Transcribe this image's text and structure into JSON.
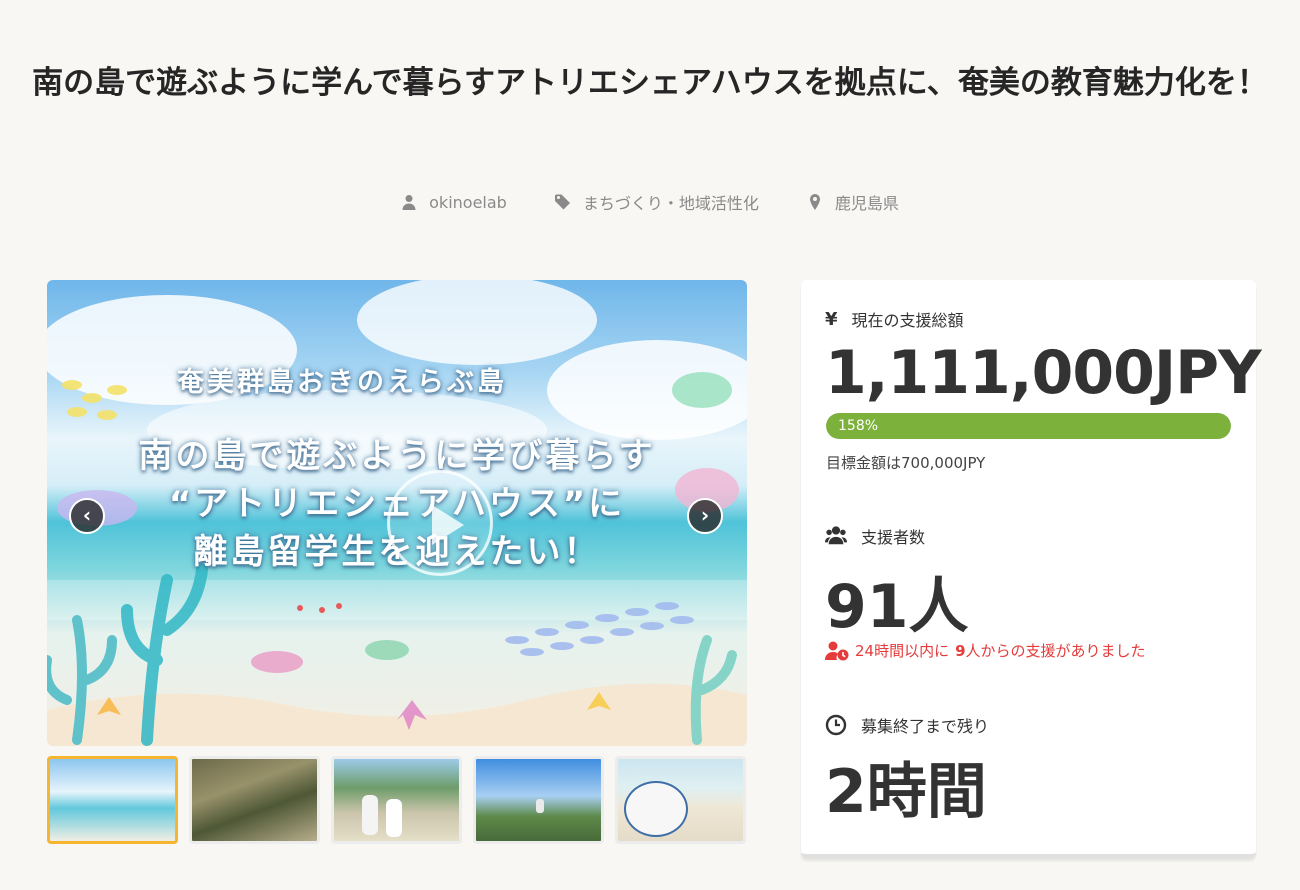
{
  "title": "南の島で遊ぶように学んで暮らすアトリエシェアハウスを拠点に、奄美の教育魅力化を！",
  "meta": {
    "owner": "okinoelab",
    "category": "まちづくり・地域活性化",
    "location": "鹿児島県",
    "owner_icon": "user-icon",
    "category_icon": "tag-icon",
    "location_icon": "map-pin-icon"
  },
  "hero": {
    "subtitle": "奄美群島おきのえらぶ島",
    "line1": "南の島で遊ぶように学び暮らす",
    "line2": "“アトリエシェアハウス”に",
    "line3": "離島留学生を迎えたい！",
    "prev_icon": "chevron-left-icon",
    "next_icon": "chevron-right-icon",
    "active_thumbnail": 1
  },
  "funding": {
    "currency_symbol": "¥",
    "amount_label": "現在の支援総額",
    "amount": "1,111,000JPY",
    "progress_text": "158%",
    "progress_percent": 158,
    "goal_text": "目標金額は700,000JPY",
    "backers_label": "支援者数",
    "backers": "91人",
    "recent_prefix": "24時間以内に",
    "recent_count": "9",
    "recent_suffix": "人からの支援がありました",
    "remaining_label": "募集終了まで残り",
    "remaining": "2時間"
  },
  "colors": {
    "progress": "#7cb13c",
    "alert": "#e53b3b",
    "active_thumb_border": "#f5b531"
  }
}
